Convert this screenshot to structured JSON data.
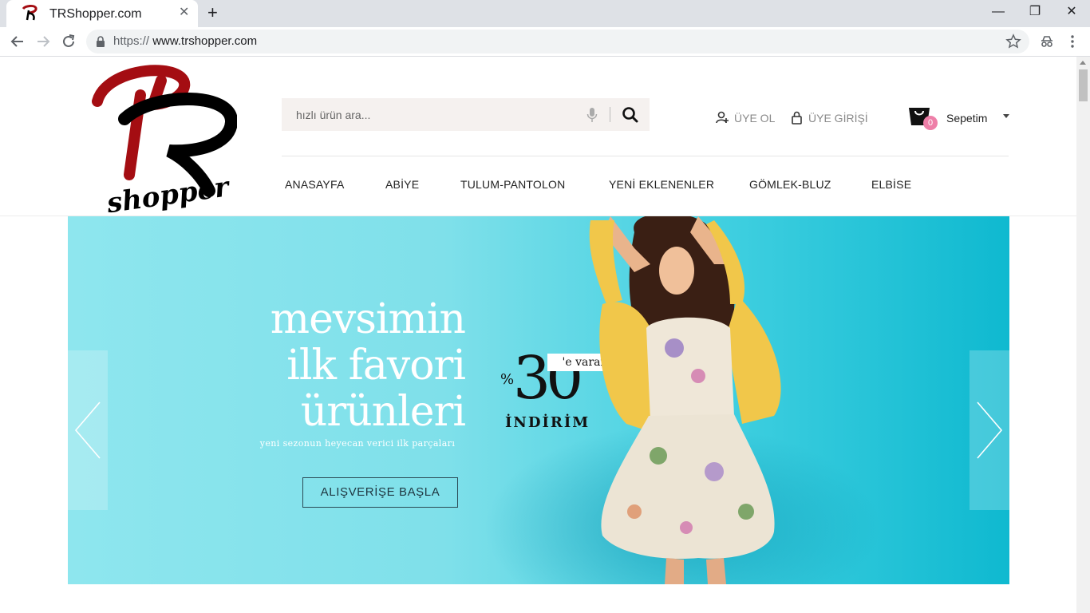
{
  "browser": {
    "tab_title": "TRShopper.com",
    "tab_close": "✕",
    "new_tab": "+",
    "url_scheme": "https://",
    "url_host": "www.trshopper.com",
    "window_controls": {
      "minimize": "—",
      "restore": "❐",
      "close": "✕"
    }
  },
  "header": {
    "search": {
      "placeholder": "hızlı ürün ara..."
    },
    "account": {
      "register": "ÜYE OL",
      "login": "ÜYE GİRİŞİ"
    },
    "cart": {
      "label": "Sepetim",
      "count": "0"
    },
    "menu": [
      "ANASAYFA",
      "ABİYE",
      "TULUM-PANTOLON",
      "YENİ EKLENENLER",
      "GÖMLEK-BLUZ",
      "ELBİSE"
    ]
  },
  "slider": {
    "headline": [
      "mevsimin",
      "ilk favori",
      "ürünleri"
    ],
    "subtitle": "yeni sezonun heyecan verici ilk parçaları",
    "cta": "ALIŞVERİŞE BAŞLA",
    "discount": {
      "percent_sign": "%",
      "value": "30",
      "tag": "'e varan",
      "word": "İNDİRİM"
    }
  },
  "colors": {
    "accent_pink": "#ee7fa8",
    "logo_red": "#a40d12",
    "slider_bg": "#7fe0ea"
  }
}
